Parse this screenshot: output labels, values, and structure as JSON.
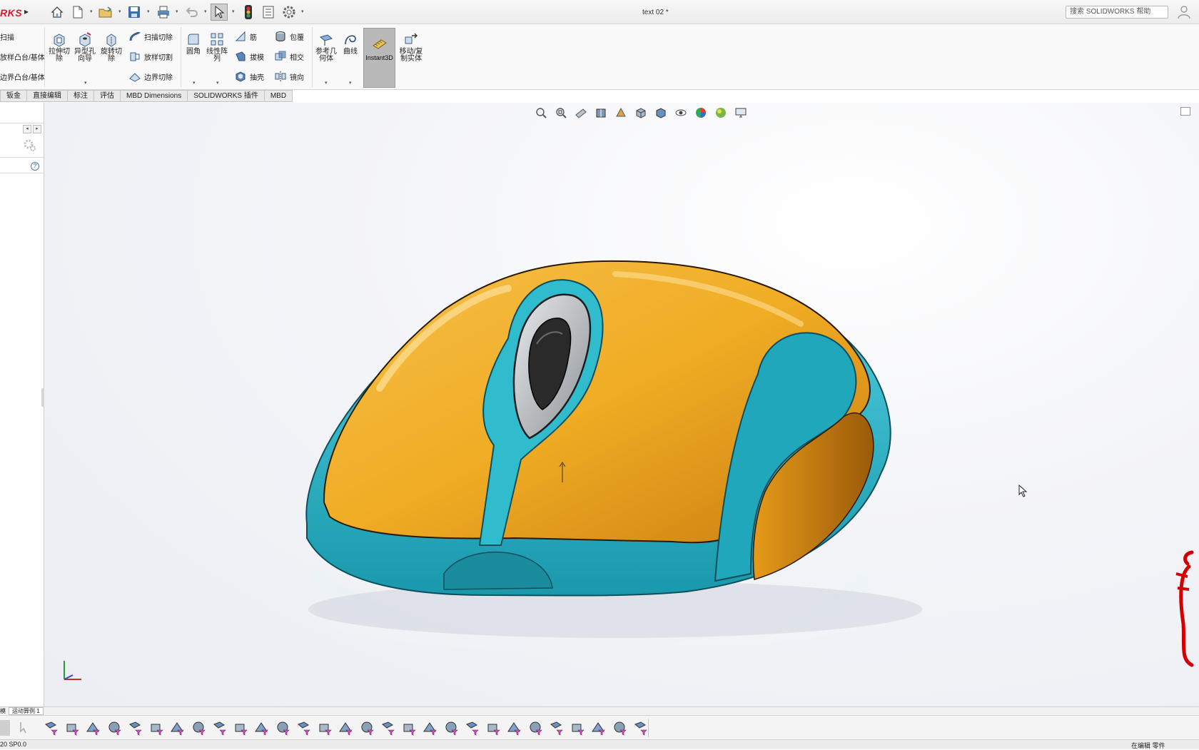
{
  "app": {
    "logo_text": "RKS",
    "document_title": "text 02 *",
    "help_search_placeholder": "搜索 SOLIDWORKS 帮助"
  },
  "title_toolbar": {
    "icons": [
      "home-icon",
      "new-document-icon",
      "open-icon",
      "save-icon",
      "print-icon",
      "undo-icon",
      "select-icon",
      "rebuild-icon",
      "file-properties-icon",
      "options-icon"
    ]
  },
  "ribbon": {
    "left_column": [
      "扫描",
      "放样凸台/基体",
      "边界凸台/基体"
    ],
    "big": {
      "extrude_cut": "拉伸切除",
      "hole_wizard": "异型孔向导",
      "revolve_cut": "旋转切除",
      "fillet": "圆角",
      "linear_pattern": "线性阵列",
      "reference_geometry": "参考几何体",
      "curves": "曲线",
      "instant3d": "Instant3D",
      "move_copy": "移动/复制实体"
    },
    "cut_column": [
      "扫描切除",
      "放样切割",
      "边界切除"
    ],
    "feature_column": [
      "筋",
      "拔模",
      "抽壳"
    ],
    "wrap_column": [
      "包覆",
      "相交",
      "镜向"
    ]
  },
  "tabs": [
    "钣金",
    "直接编辑",
    "标注",
    "评估",
    "MBD Dimensions",
    "SOLIDWORKS 插件",
    "MBD"
  ],
  "left_panel": {
    "help_symbol": "?"
  },
  "bottom_tabs": {
    "model_tab": "模",
    "motion_tab": "运动算例 1"
  },
  "status": {
    "version": "20 SP0.0",
    "editing": "在编辑 零件"
  },
  "colors": {
    "accent_orange": "#f0ac24",
    "accent_cyan": "#2bb8cc",
    "brand_red": "#d01f2a"
  }
}
